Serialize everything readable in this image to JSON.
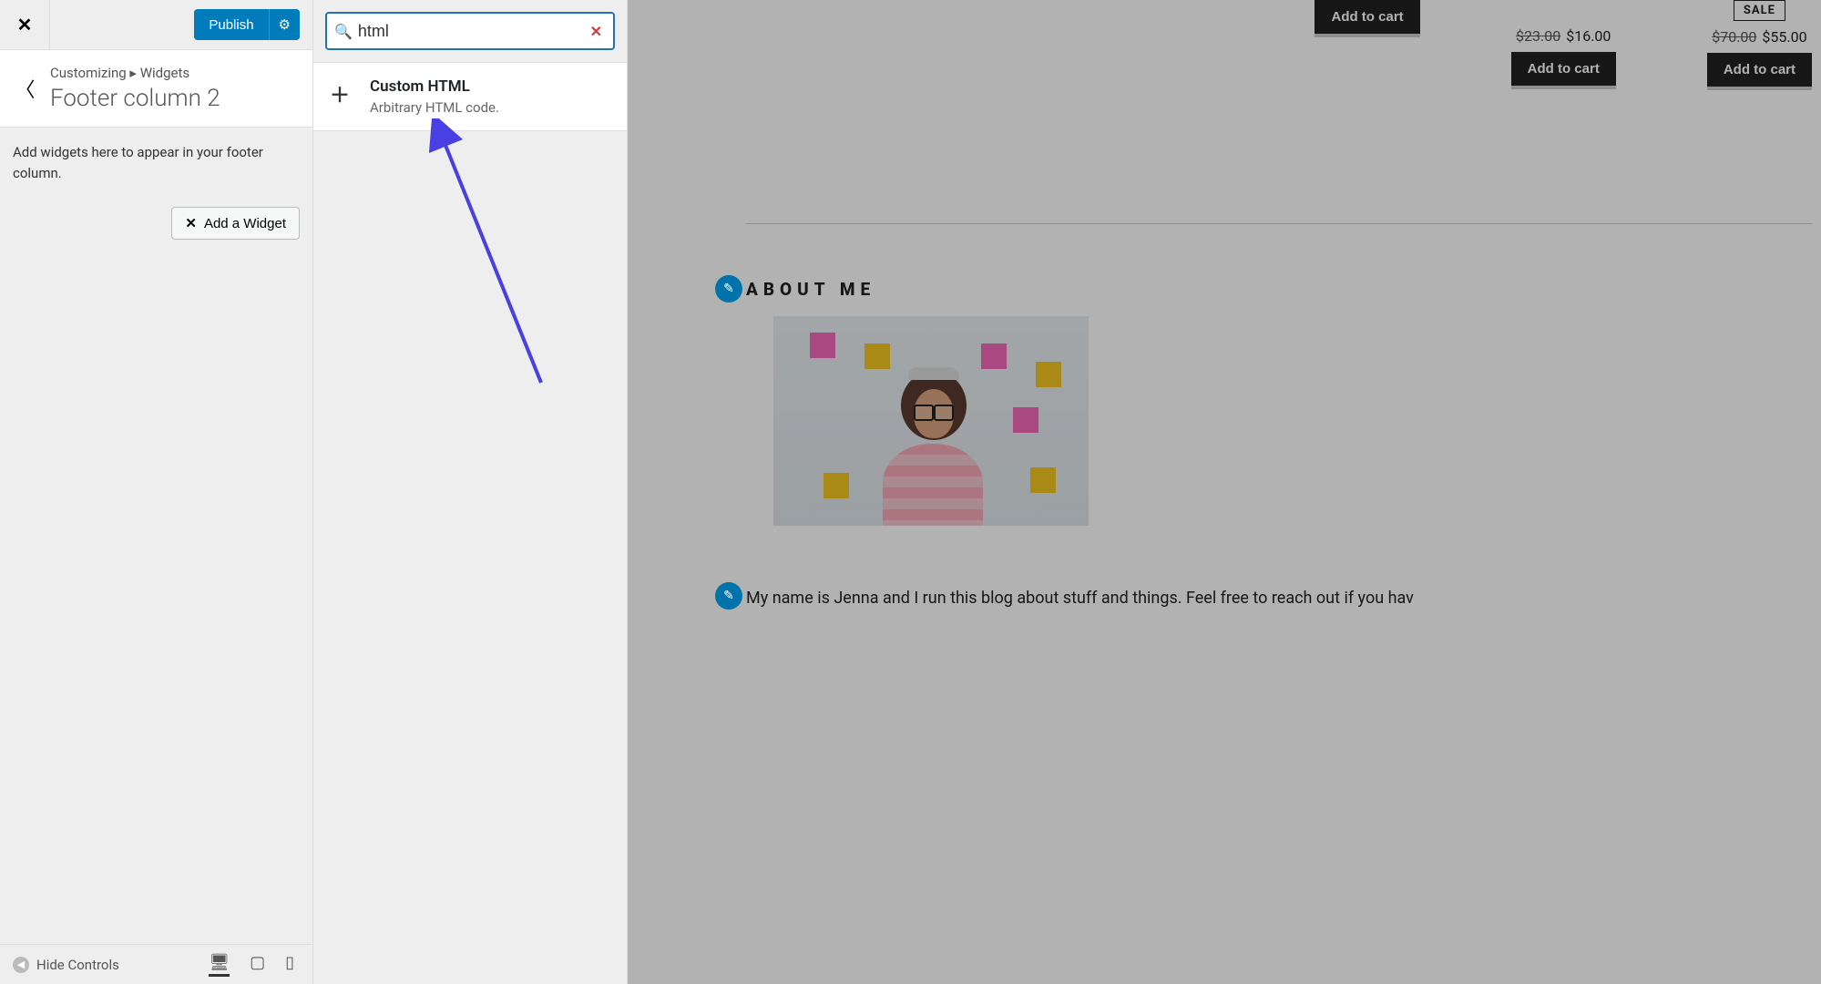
{
  "customizer": {
    "publish_label": "Publish",
    "breadcrumb": {
      "level1": "Customizing",
      "sep": "▸",
      "level2": "Widgets"
    },
    "section_title": "Footer column 2",
    "panel_desc": "Add widgets here to appear in your footer column.",
    "add_widget_label": "Add a Widget",
    "footer": {
      "hide_controls": "Hide Controls"
    }
  },
  "widget_search": {
    "query": "html",
    "result": {
      "name": "Custom HTML",
      "desc": "Arbitrary HTML code."
    }
  },
  "preview": {
    "products": [
      {
        "add_label": "Add to cart"
      },
      {
        "old_price": "$23.00",
        "new_price": "$16.00",
        "add_label": "Add to cart"
      },
      {
        "badge": "SALE",
        "old_price": "$70.00",
        "new_price": "$55.00",
        "add_label": "Add to cart"
      }
    ],
    "about": {
      "heading": "ABOUT ME",
      "text": "My name is Jenna and I run this blog about stuff and things. Feel free to reach out if you hav"
    }
  }
}
